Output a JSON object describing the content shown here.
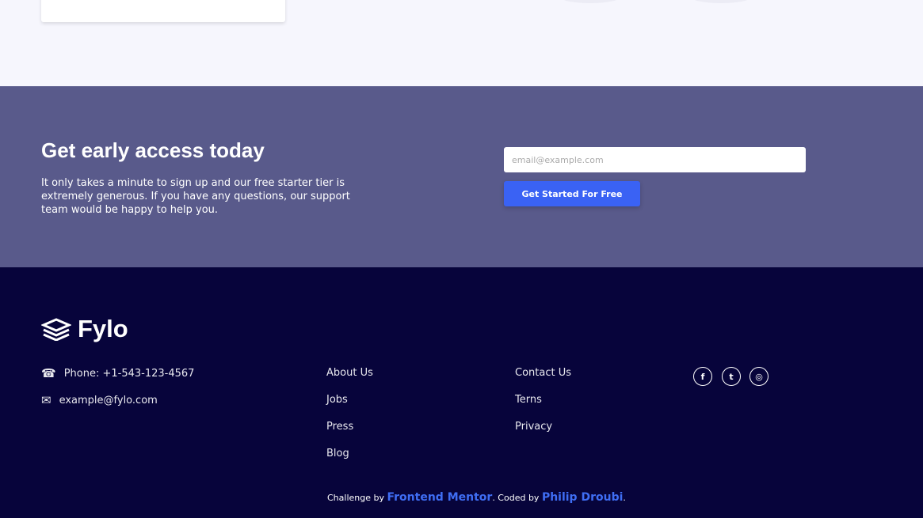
{
  "cta": {
    "title": "Get early access today",
    "text": "It only takes a minute to sign up and our free starter tier is extremely generous. If you have any questions, our support team would be happy to help you.",
    "email_placeholder": "email@example.com",
    "button": "Get Started For Free"
  },
  "footer": {
    "logo": "Fylo",
    "phone": "Phone: +1-543-123-4567",
    "email": "example@fylo.com",
    "col1": [
      "About Us",
      "Jobs",
      "Press",
      "Blog"
    ],
    "col2": [
      "Contact Us",
      "Terns",
      "Privacy"
    ],
    "social": [
      "facebook-icon",
      "twitter-icon",
      "instagram-icon"
    ],
    "credit": {
      "prefix": "Challenge by ",
      "link1": "Frontend Mentor",
      "middle": ". Coded by ",
      "link2": "Philip Droubi",
      "suffix": "."
    }
  }
}
